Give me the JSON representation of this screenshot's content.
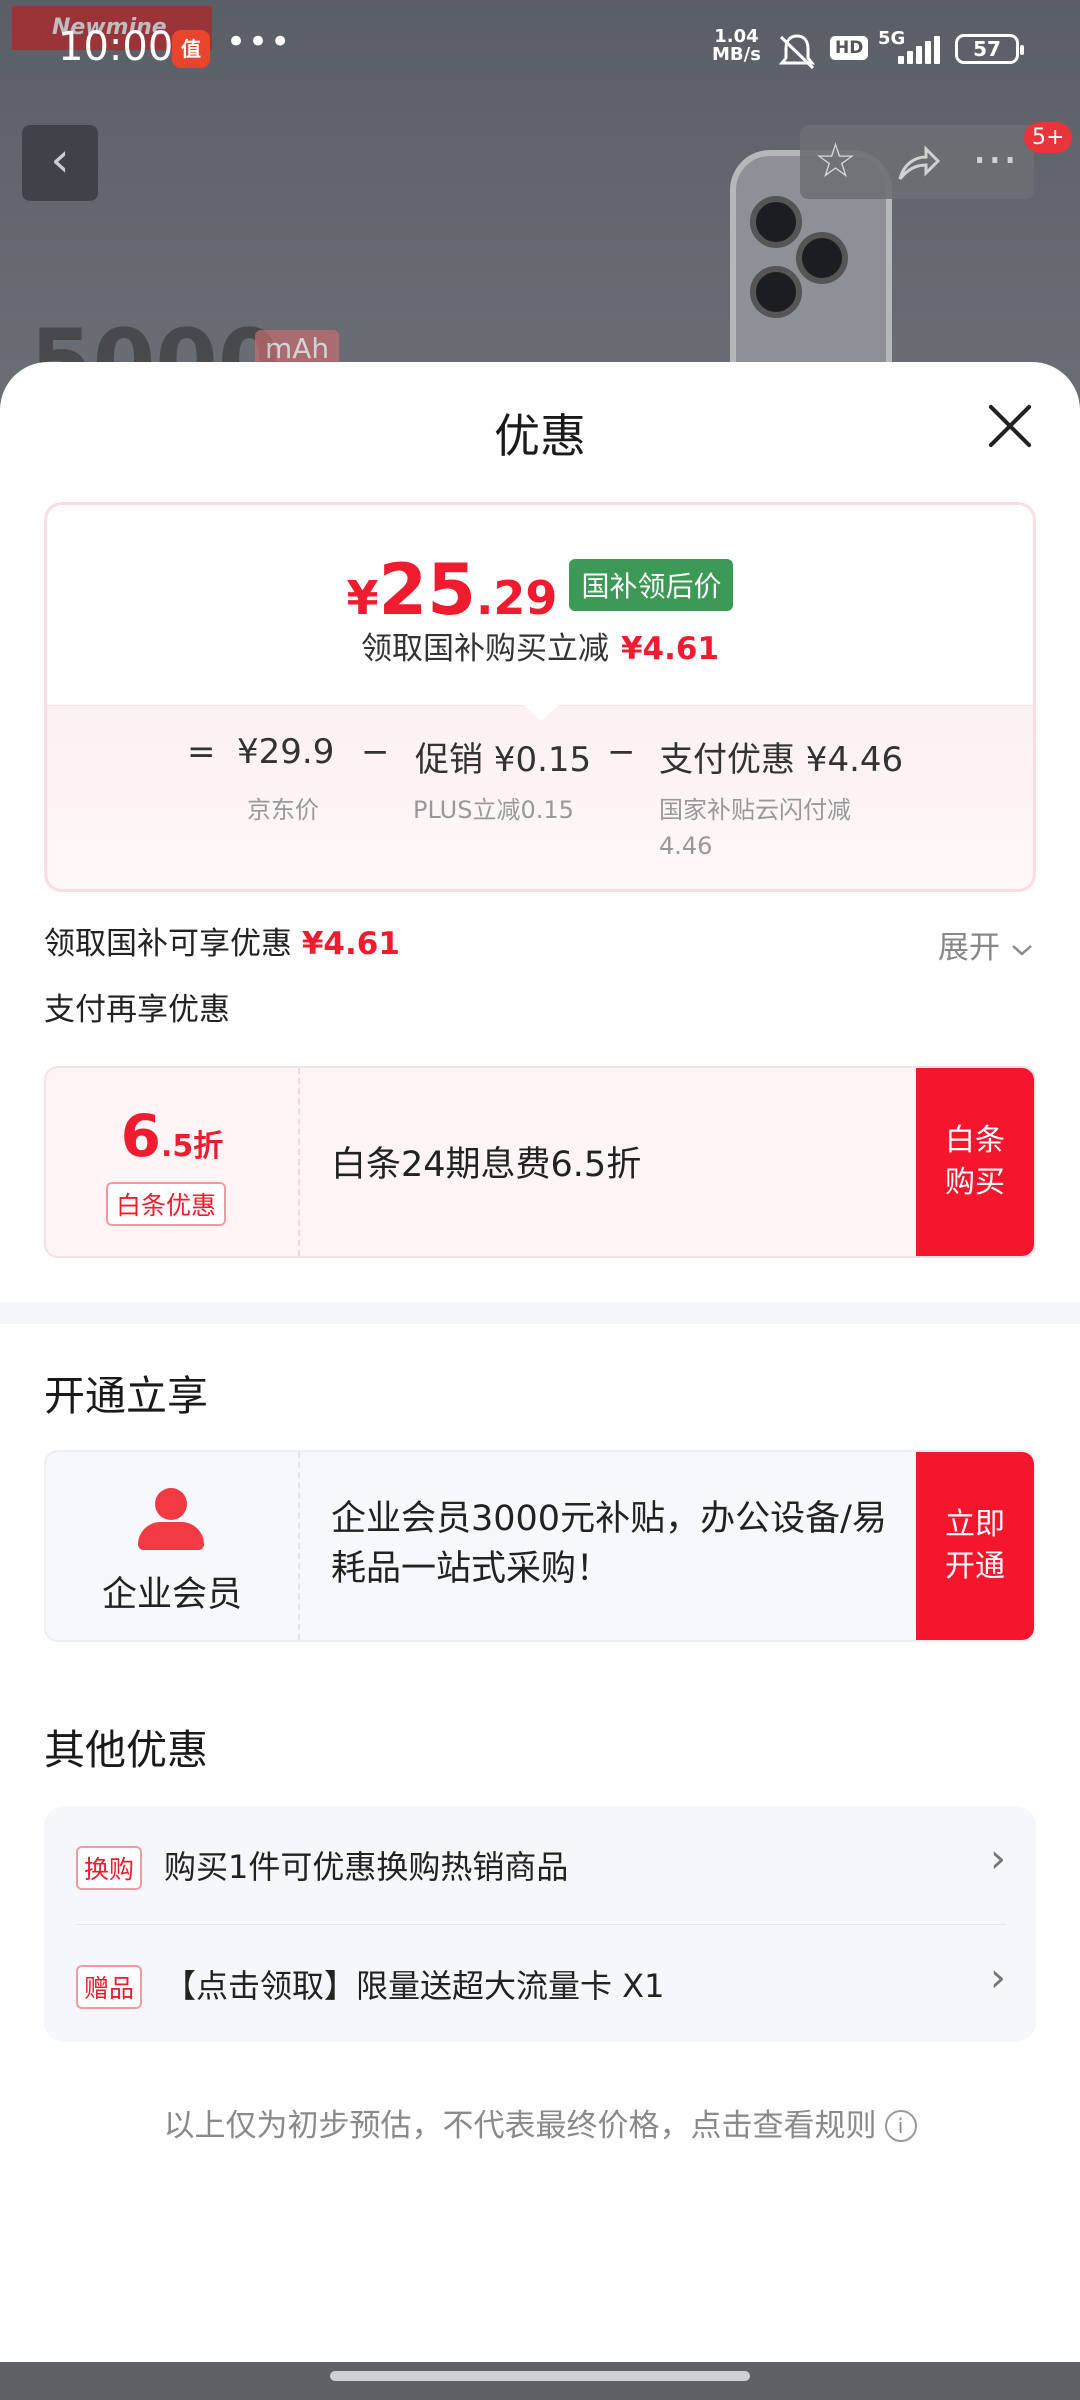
{
  "status_bar": {
    "time": "10:00",
    "net_speed": "1.04",
    "net_unit": "MB/s",
    "hd": "HD",
    "signal": "5G",
    "battery": "57"
  },
  "background": {
    "brand": "Newmine",
    "big_text": "5000",
    "unit": "mAh",
    "cart_badge": "5+"
  },
  "sheet": {
    "title": "优惠"
  },
  "price": {
    "yen": "¥",
    "integer": "25",
    "decimal": ".29",
    "tag": "国补领后价",
    "sub_label": "领取国补购买立减",
    "sub_amount": "¥4.61"
  },
  "formula": {
    "eq": "=",
    "jd_price": "¥29.9",
    "jd_label": "京东价",
    "minus1": "−",
    "promo": "促销 ¥0.15",
    "promo_label": "PLUS立减0.15",
    "minus2": "−",
    "pay": "支付优惠 ¥4.46",
    "pay_label_1": "国家补贴云闪付减",
    "pay_label_2": "4.46"
  },
  "subsidy_line": {
    "label": "领取国补可享优惠",
    "amount": "¥4.61",
    "expand": "展开"
  },
  "pay_line": "支付再享优惠",
  "baitiao": {
    "discount_big": "6",
    "discount_small": ".5折",
    "tag": "白条优惠",
    "desc": "白条24期息费6.5折",
    "cta": "白条\n购买"
  },
  "open_section": {
    "heading": "开通立享",
    "member_name": "企业会员",
    "desc": "企业会员3000元补贴，办公设备/易耗品一站式采购！",
    "cta": "立即\n开通"
  },
  "other_section": {
    "heading": "其他优惠",
    "items": [
      {
        "tag": "换购",
        "text": "购买1件可优惠换购热销商品"
      },
      {
        "tag": "赠品",
        "text": "【点击领取】限量送超大流量卡 X1"
      }
    ]
  },
  "footnote": "以上仅为初步预估，不代表最终价格，点击查看规则",
  "icons": [
    "back-arrow-icon",
    "star-icon",
    "share-icon",
    "more-icon",
    "close-icon",
    "chevron-down-icon",
    "chevron-right-icon",
    "info-icon",
    "person-icon"
  ],
  "colors": {
    "accent_red": "#ee1c2e",
    "cta_red": "#f5152d",
    "tag_green": "#3d9a56"
  }
}
